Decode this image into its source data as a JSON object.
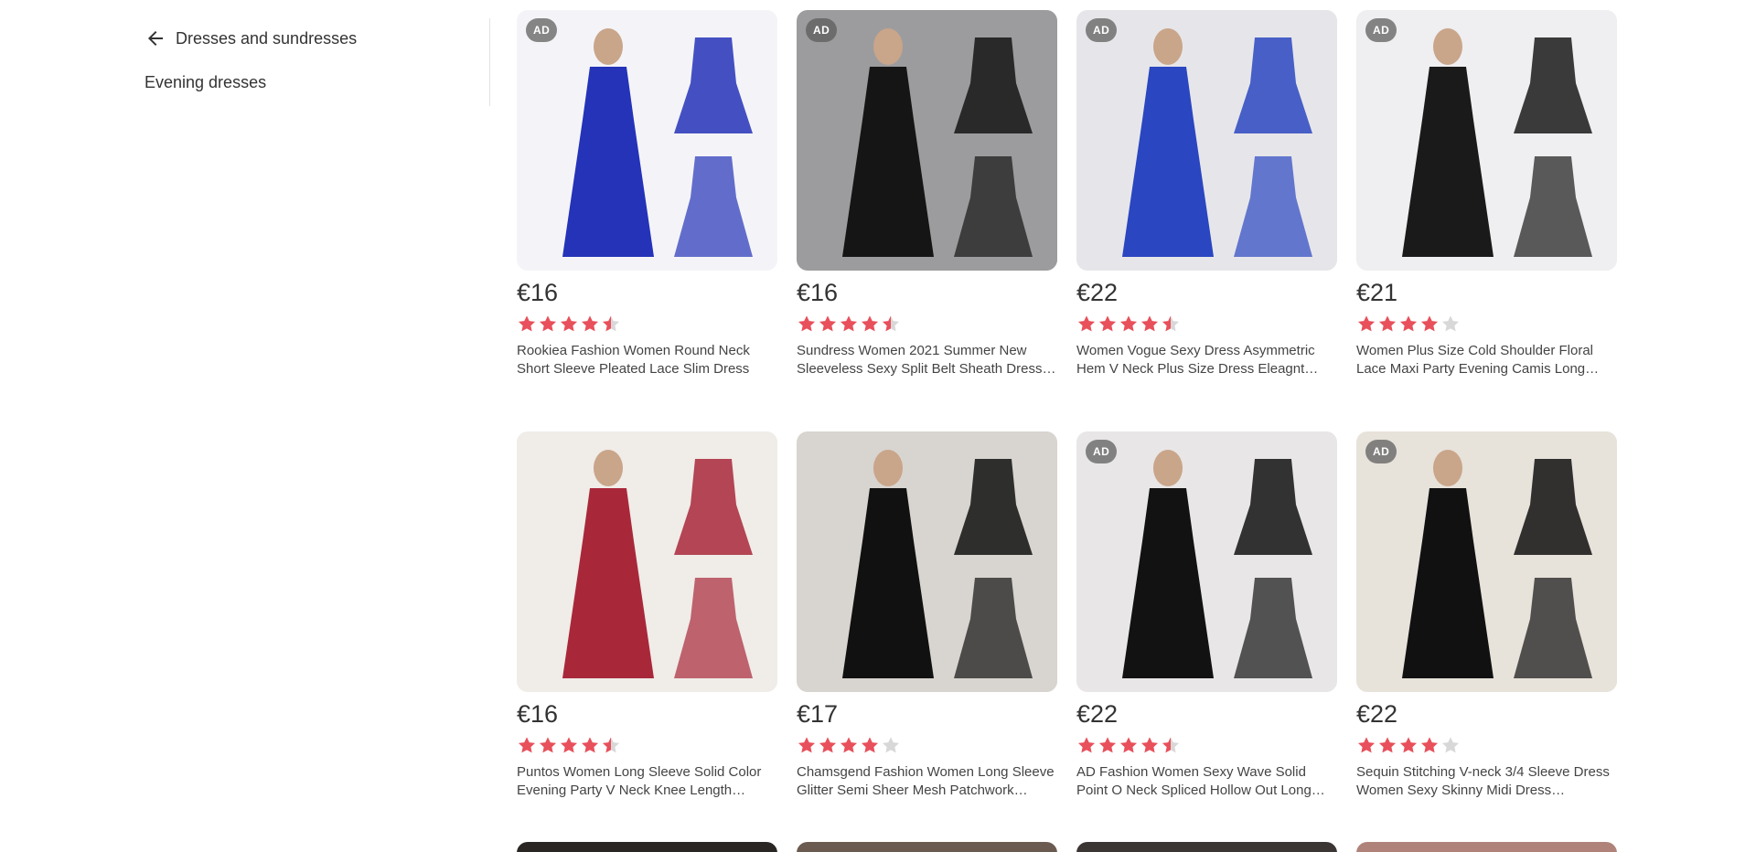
{
  "nav": {
    "back_label": "Dresses and sundresses",
    "sub_link": "Evening dresses"
  },
  "products": [
    {
      "badge": "AD",
      "price": "€16",
      "rating": 4.5,
      "title": "Rookiea Fashion Women Round Neck Short Sleeve Pleated Lace Slim Dress",
      "color": "#2433b8",
      "bg": "#f4f4f8"
    },
    {
      "badge": "AD",
      "price": "€16",
      "rating": 4.5,
      "title": "Sundress Women 2021 Summer New Sleeveless Sexy Split Belt Sheath Dress…",
      "color": "#151515",
      "bg": "#9c9c9e"
    },
    {
      "badge": "AD",
      "price": "€22",
      "rating": 4.5,
      "title": "Women Vogue Sexy Dress Asymmetric Hem V Neck Plus Size Dress Eleagnt Part…",
      "color": "#2a46c0",
      "bg": "#e6e6ea"
    },
    {
      "badge": "AD",
      "price": "€21",
      "rating": 4,
      "title": "Women Plus Size Cold Shoulder Floral Lace Maxi Party Evening Camis Long…",
      "color": "#1a1a1a",
      "bg": "#efeef0"
    },
    {
      "badge": "",
      "price": "€16",
      "rating": 4.5,
      "title": "Puntos Women Long Sleeve Solid Color Evening Party V Neck Knee Length…",
      "color": "#a8283a",
      "bg": "#f0ece8"
    },
    {
      "badge": "",
      "price": "€17",
      "rating": 4,
      "title": "Chamsgend Fashion Women Long Sleeve Glitter Semi Sheer Mesh Patchwork Slim…",
      "color": "#111111",
      "bg": "#d8d4cf"
    },
    {
      "badge": "AD",
      "price": "€22",
      "rating": 4.5,
      "title": "AD Fashion Women Sexy Wave Solid Point O Neck Spliced Hollow Out Long Sleeve…",
      "color": "#121212",
      "bg": "#e8e6e6"
    },
    {
      "badge": "AD",
      "price": "€22",
      "rating": 4,
      "title": "Sequin Stitching V-neck 3/4 Sleeve Dress Women Sexy Skinny Midi Dress Cocktail…",
      "color": "#111111",
      "bg": "#e7e2da"
    }
  ],
  "colors": {
    "star_filled": "#e8505b",
    "star_empty": "#d8d8d8"
  }
}
